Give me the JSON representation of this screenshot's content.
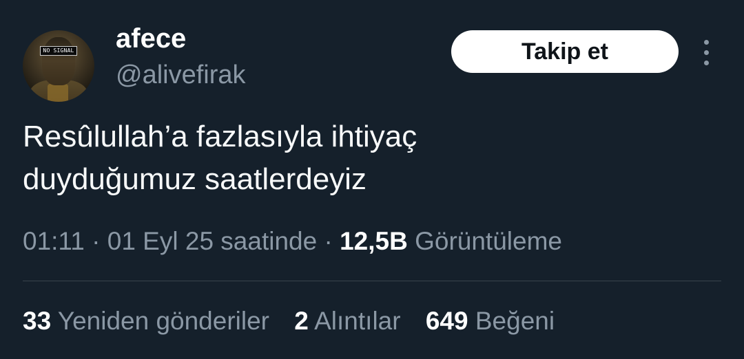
{
  "author": {
    "display_name": "afece",
    "handle": "@alivefirak",
    "avatar_overlay_text": "NO SIGNAL"
  },
  "actions": {
    "follow_label": "Takip et",
    "more_icon": "more-vertical-icon"
  },
  "tweet": {
    "text_lines": [
      "Resûlullah’a fazlasıyla ihtiyaç",
      "duyduğumuz saatlerdeyiz"
    ]
  },
  "meta": {
    "time": "01:11",
    "separator": "·",
    "date": "01 Eyl 25 saatinde",
    "views_count": "12,5B",
    "views_label": "Görüntüleme"
  },
  "stats": {
    "retweets_count": "33",
    "retweets_label": "Yeniden gönderiler",
    "quotes_count": "2",
    "quotes_label": "Alıntılar",
    "likes_count": "649",
    "likes_label": "Beğeni"
  },
  "colors": {
    "background": "#15202b",
    "text_primary": "#ffffff",
    "text_secondary": "#8b98a5",
    "divider": "#38444d",
    "button_bg": "#ffffff",
    "button_text": "#0f1419"
  }
}
